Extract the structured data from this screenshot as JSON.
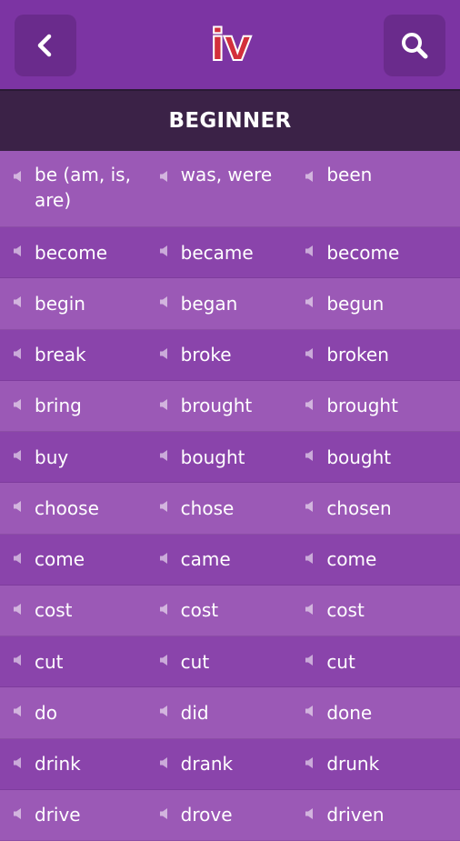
{
  "header": {
    "back_icon": "chevron-left-icon",
    "logo_text": "iv",
    "search_icon": "search-icon"
  },
  "level": {
    "title": "BEGINNER"
  },
  "colors": {
    "topbar": "#7c34a3",
    "button": "#6a2b8c",
    "titlebar": "#3b2247",
    "row_light": "#9b59b6",
    "row_dark": "#8a44ab",
    "logo_red": "#d32f3b",
    "logo_blue": "#1b3a8c"
  },
  "verbs": [
    {
      "base": "be (am, is, are)",
      "past": "was, were",
      "participle": "been"
    },
    {
      "base": "become",
      "past": "became",
      "participle": "become"
    },
    {
      "base": "begin",
      "past": "began",
      "participle": "begun"
    },
    {
      "base": "break",
      "past": "broke",
      "participle": "broken"
    },
    {
      "base": "bring",
      "past": "brought",
      "participle": "brought"
    },
    {
      "base": "buy",
      "past": "bought",
      "participle": "bought"
    },
    {
      "base": "choose",
      "past": "chose",
      "participle": "chosen"
    },
    {
      "base": "come",
      "past": "came",
      "participle": "come"
    },
    {
      "base": "cost",
      "past": "cost",
      "participle": "cost"
    },
    {
      "base": "cut",
      "past": "cut",
      "participle": "cut"
    },
    {
      "base": "do",
      "past": "did",
      "participle": "done"
    },
    {
      "base": "drink",
      "past": "drank",
      "participle": "drunk"
    },
    {
      "base": "drive",
      "past": "drove",
      "participle": "driven"
    }
  ]
}
